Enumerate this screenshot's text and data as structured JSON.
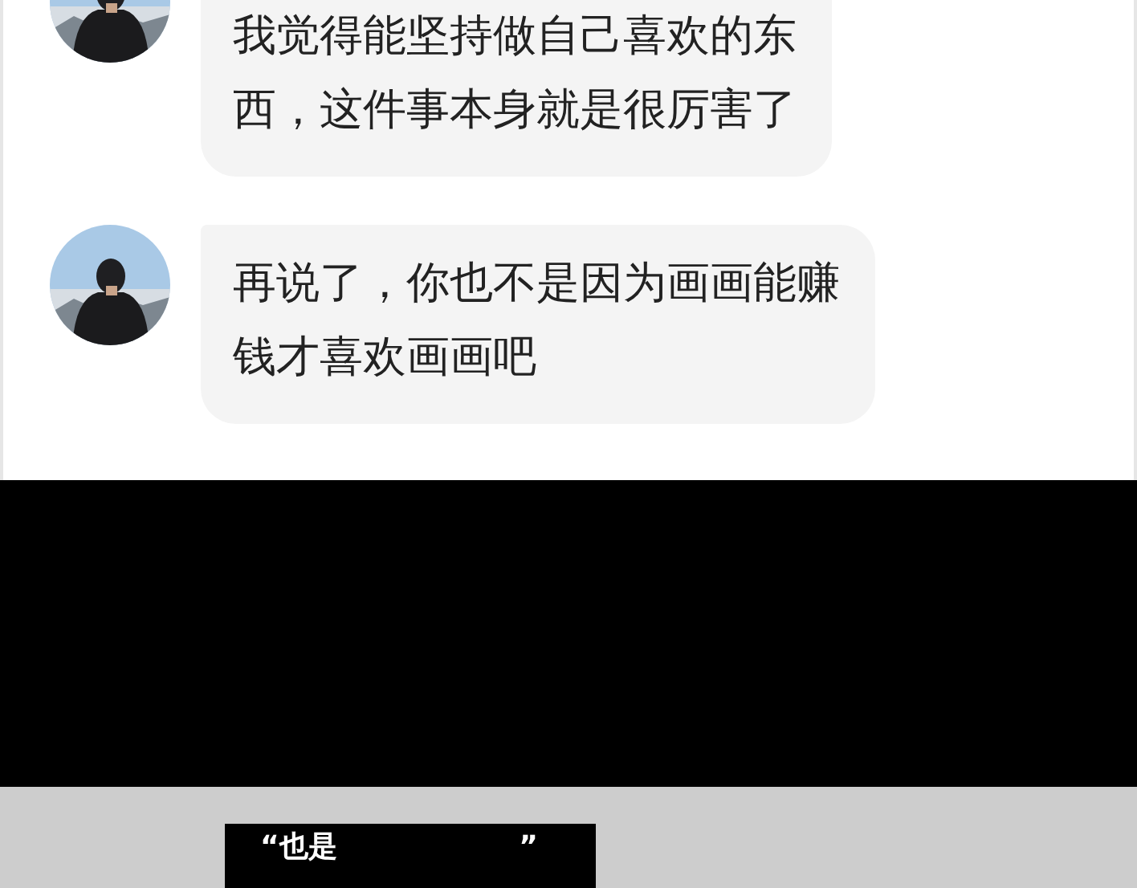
{
  "messages": [
    {
      "lines": [
        "我觉得能坚持做自己喜欢的东",
        "西，这件事本身就是很厉害了"
      ]
    },
    {
      "lines": [
        "再说了，你也不是因为画画能赚",
        "钱才喜欢画画吧"
      ]
    }
  ],
  "caption": {
    "open": "“也是",
    "close": "”"
  }
}
